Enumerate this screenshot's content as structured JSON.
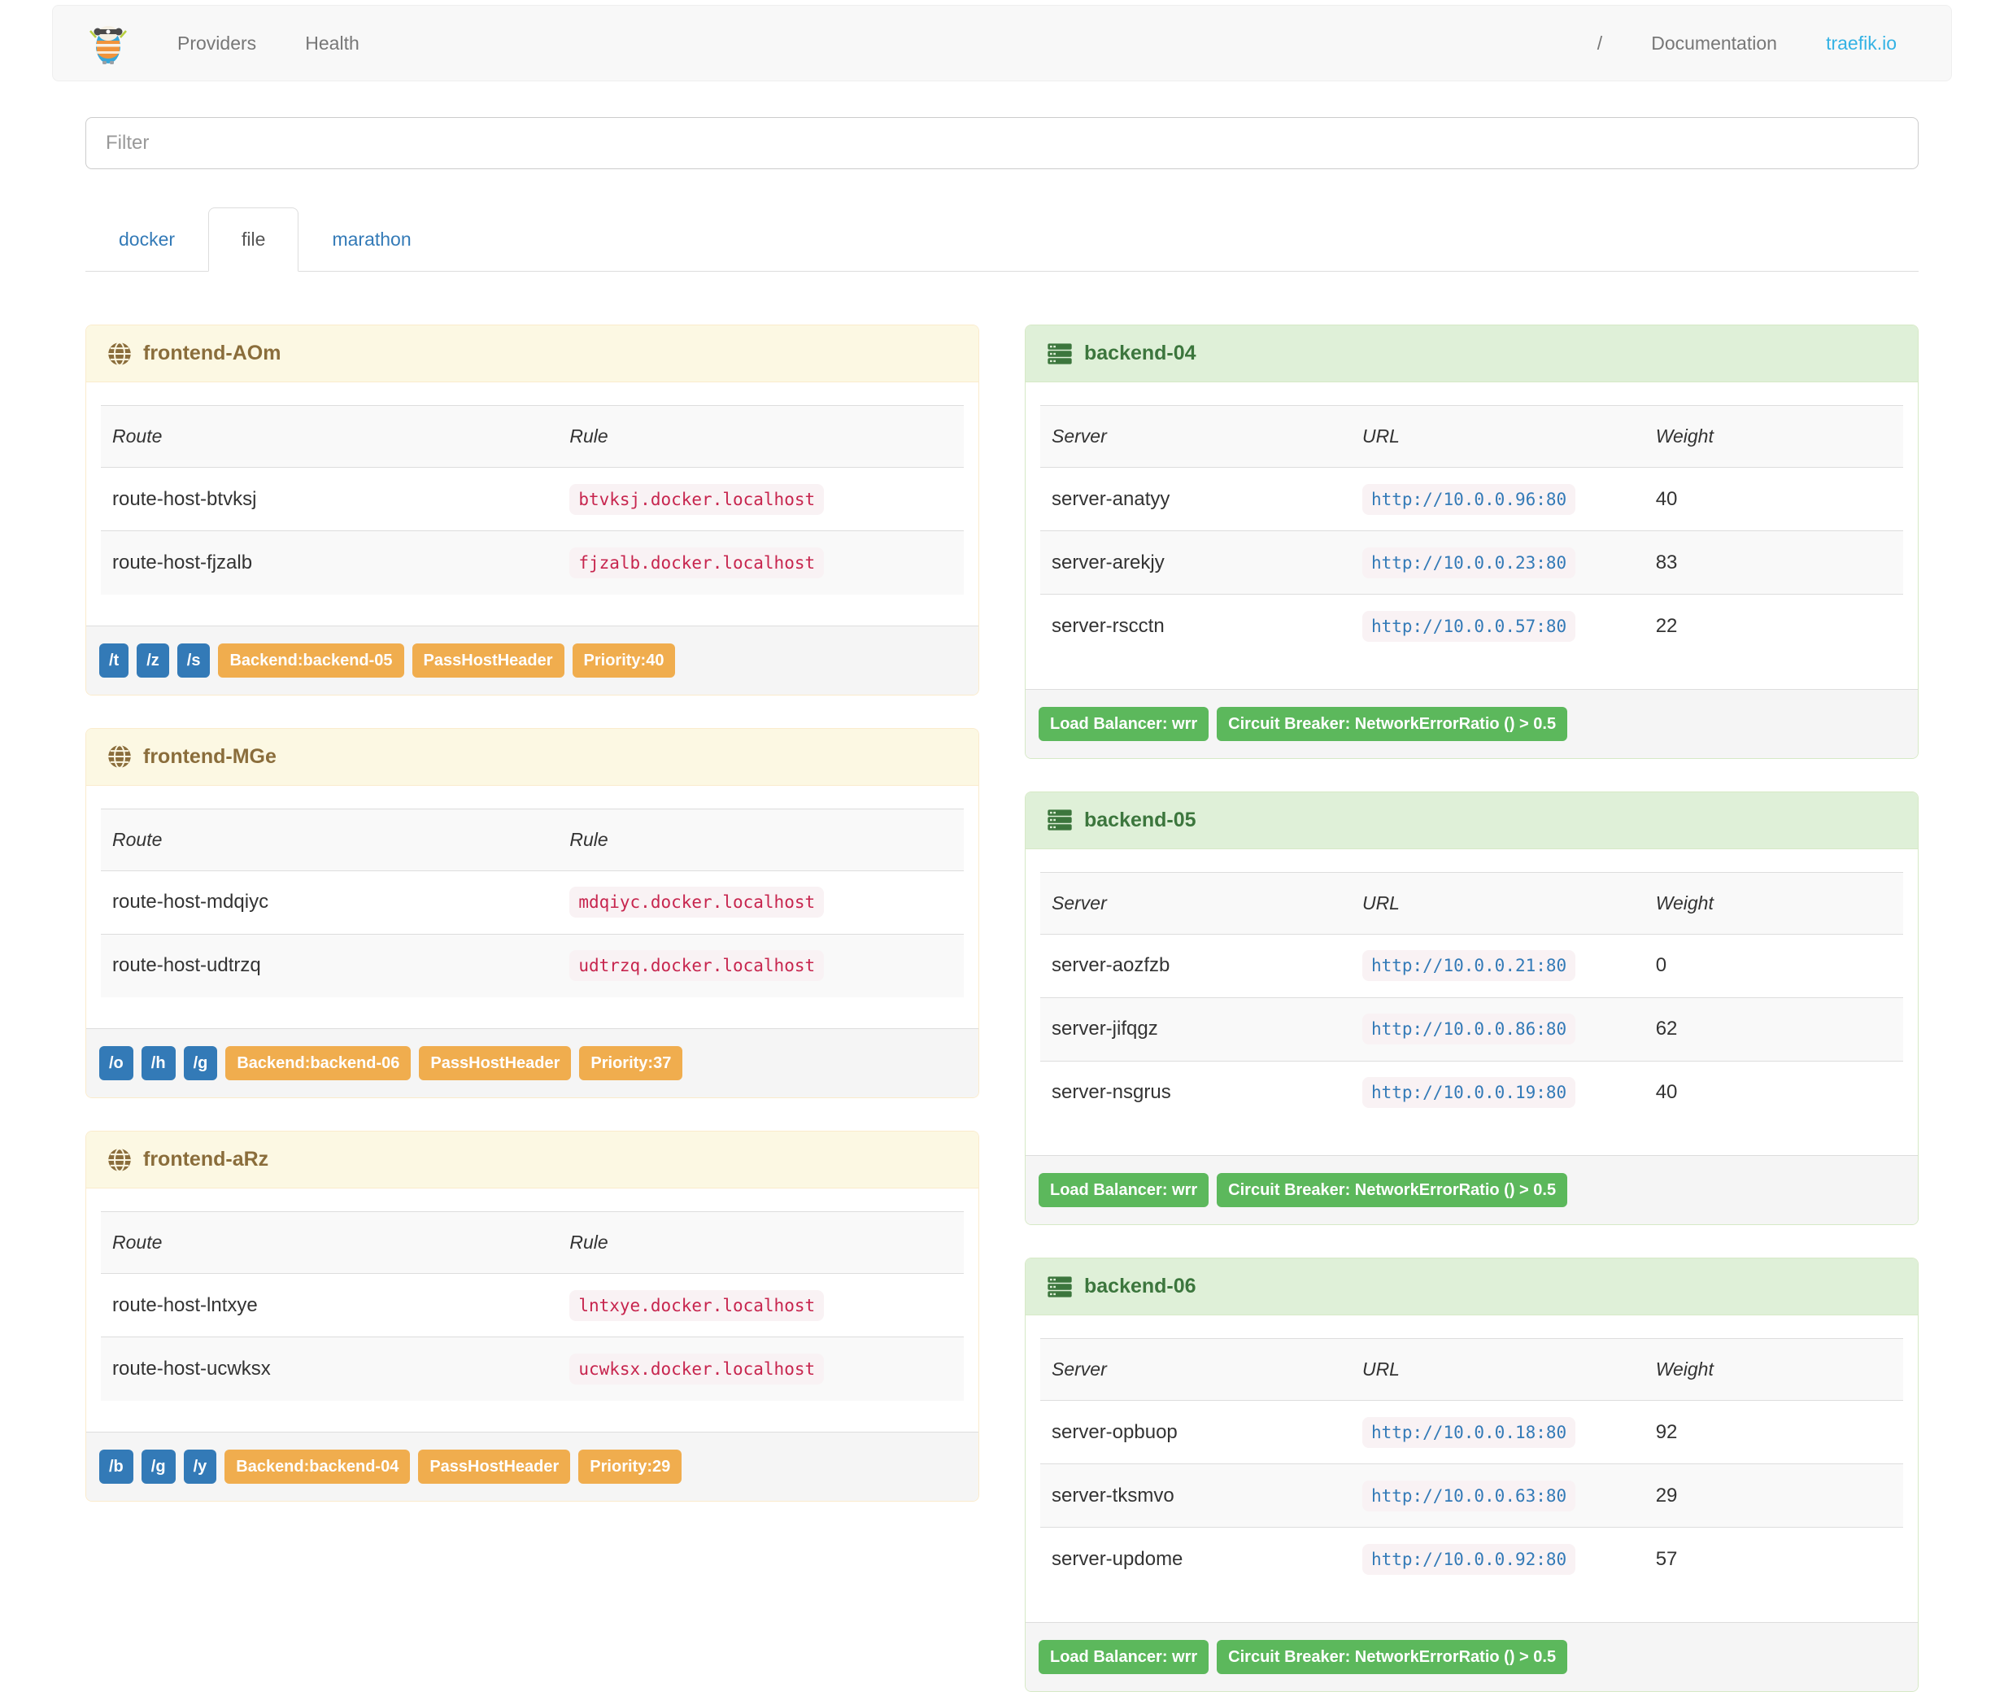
{
  "colors": {
    "accent_link": "#34b2e4",
    "navbar_text": "#777777",
    "tab_link": "#337ab7",
    "warning_heading_bg": "#fcf8e3",
    "warning_border": "#faebcc",
    "warning_text": "#8a6d3b",
    "success_heading_bg": "#dff0d8",
    "success_border": "#d6e9c6",
    "success_text": "#3c763d",
    "label_blue": "#337ab7",
    "label_orange": "#f0ad4e",
    "label_green": "#5cb85c",
    "code_rule_text": "#c7254e",
    "code_url_text": "#337ab7",
    "code_bg": "#f9f2f4"
  },
  "navbar": {
    "left": [
      {
        "label": "Providers"
      },
      {
        "label": "Health"
      }
    ],
    "right": [
      {
        "label": "/"
      },
      {
        "label": "Documentation"
      },
      {
        "label": "traefik.io"
      }
    ]
  },
  "filter": {
    "placeholder": "Filter"
  },
  "tabs": [
    {
      "label": "docker",
      "active": false
    },
    {
      "label": "file",
      "active": true
    },
    {
      "label": "marathon",
      "active": false
    }
  ],
  "table_headers": {
    "frontend": [
      "Route",
      "Rule"
    ],
    "backend": [
      "Server",
      "URL",
      "Weight"
    ]
  },
  "frontends": [
    {
      "title": "frontend-AOm",
      "routes": [
        {
          "route": "route-host-btvksj",
          "rule": "btvksj.docker.localhost"
        },
        {
          "route": "route-host-fjzalb",
          "rule": "fjzalb.docker.localhost"
        }
      ],
      "entrypoints": [
        "/t",
        "/z",
        "/s"
      ],
      "labels": [
        "Backend:backend-05",
        "PassHostHeader",
        "Priority:40"
      ]
    },
    {
      "title": "frontend-MGe",
      "routes": [
        {
          "route": "route-host-mdqiyc",
          "rule": "mdqiyc.docker.localhost"
        },
        {
          "route": "route-host-udtrzq",
          "rule": "udtrzq.docker.localhost"
        }
      ],
      "entrypoints": [
        "/o",
        "/h",
        "/g"
      ],
      "labels": [
        "Backend:backend-06",
        "PassHostHeader",
        "Priority:37"
      ]
    },
    {
      "title": "frontend-aRz",
      "routes": [
        {
          "route": "route-host-lntxye",
          "rule": "lntxye.docker.localhost"
        },
        {
          "route": "route-host-ucwksx",
          "rule": "ucwksx.docker.localhost"
        }
      ],
      "entrypoints": [
        "/b",
        "/g",
        "/y"
      ],
      "labels": [
        "Backend:backend-04",
        "PassHostHeader",
        "Priority:29"
      ]
    }
  ],
  "backends": [
    {
      "title": "backend-04",
      "servers": [
        {
          "server": "server-anatyy",
          "url": "http://10.0.0.96:80",
          "weight": "40"
        },
        {
          "server": "server-arekjy",
          "url": "http://10.0.0.23:80",
          "weight": "83"
        },
        {
          "server": "server-rscctn",
          "url": "http://10.0.0.57:80",
          "weight": "22"
        }
      ],
      "labels": [
        "Load Balancer: wrr",
        "Circuit Breaker: NetworkErrorRatio () > 0.5"
      ]
    },
    {
      "title": "backend-05",
      "servers": [
        {
          "server": "server-aozfzb",
          "url": "http://10.0.0.21:80",
          "weight": "0"
        },
        {
          "server": "server-jifqgz",
          "url": "http://10.0.0.86:80",
          "weight": "62"
        },
        {
          "server": "server-nsgrus",
          "url": "http://10.0.0.19:80",
          "weight": "40"
        }
      ],
      "labels": [
        "Load Balancer: wrr",
        "Circuit Breaker: NetworkErrorRatio () > 0.5"
      ]
    },
    {
      "title": "backend-06",
      "servers": [
        {
          "server": "server-opbuop",
          "url": "http://10.0.0.18:80",
          "weight": "92"
        },
        {
          "server": "server-tksmvo",
          "url": "http://10.0.0.63:80",
          "weight": "29"
        },
        {
          "server": "server-updome",
          "url": "http://10.0.0.92:80",
          "weight": "57"
        }
      ],
      "labels": [
        "Load Balancer: wrr",
        "Circuit Breaker: NetworkErrorRatio () > 0.5"
      ]
    }
  ]
}
